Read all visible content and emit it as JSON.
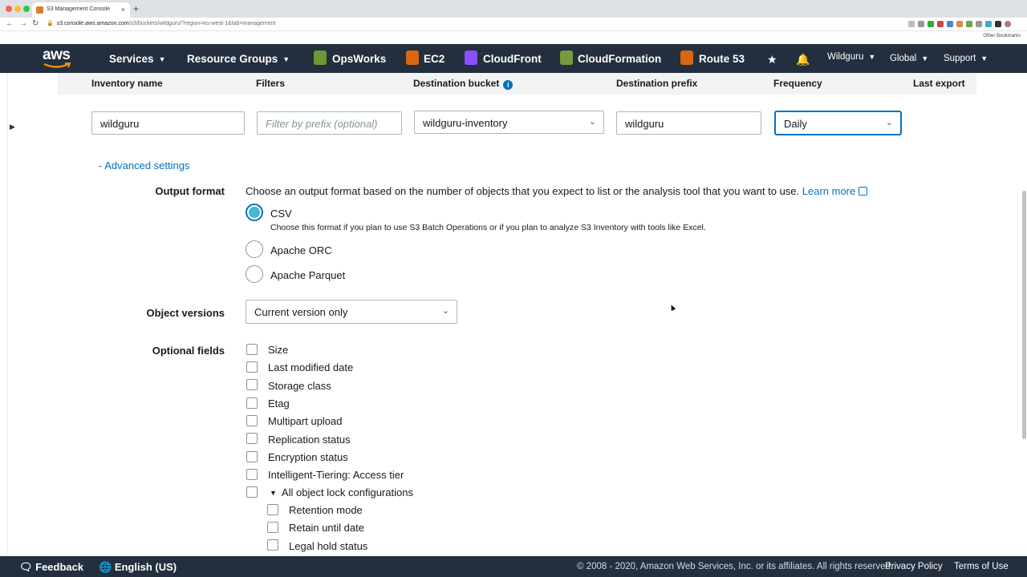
{
  "browser": {
    "tab_title": "S3 Management Console",
    "tab_close": "×",
    "new_tab": "+",
    "url_host": "s3.console.aws.amazon.com",
    "url_path": "/s3/buckets/wildguru/?region=eu-west-1&tab=management",
    "other_bookmarks": "Other Bookmarks"
  },
  "nav": {
    "logo": "aws",
    "services": "Services",
    "resource_groups": "Resource Groups",
    "opsworks": "OpsWorks",
    "ec2": "EC2",
    "cloudfront": "CloudFront",
    "cloudformation": "CloudFormation",
    "route53": "Route 53",
    "account": "Wildguru",
    "region": "Global",
    "support": "Support"
  },
  "columns": {
    "inventory_name": "Inventory name",
    "filters": "Filters",
    "destination_bucket": "Destination bucket",
    "destination_prefix": "Destination prefix",
    "frequency": "Frequency",
    "last_export": "Last export"
  },
  "form": {
    "inventory_name_value": "wildguru",
    "filter_placeholder": "Filter by prefix (optional)",
    "destination_bucket_value": "wildguru-inventory",
    "destination_prefix_value": "wildguru",
    "frequency_value": "Daily"
  },
  "advanced": {
    "toggle_label": "- Advanced settings",
    "output_format_label": "Output format",
    "output_format_desc": "Choose an output format based on the number of objects that you expect to list or the analysis tool that you want to use.",
    "learn_more": "Learn more",
    "formats": [
      {
        "label": "CSV",
        "checked": true
      },
      {
        "label": "Apache ORC",
        "checked": false
      },
      {
        "label": "Apache Parquet",
        "checked": false
      }
    ],
    "csv_hint": "Choose this format if you plan to use S3 Batch Operations or if you plan to analyze S3 Inventory with tools like Excel.",
    "object_versions_label": "Object versions",
    "object_versions_value": "Current version only",
    "optional_fields_label": "Optional fields",
    "optional_fields": [
      "Size",
      "Last modified date",
      "Storage class",
      "Etag",
      "Multipart upload",
      "Replication status",
      "Encryption status",
      "Intelligent-Tiering: Access tier",
      "All object lock configurations"
    ],
    "lock_subfields": [
      "Retention mode",
      "Retain until date",
      "Legal hold status"
    ]
  },
  "footer": {
    "feedback": "Feedback",
    "language": "English (US)",
    "copyright": "© 2008 - 2020, Amazon Web Services, Inc. or its affiliates. All rights reserved.",
    "privacy": "Privacy Policy",
    "terms": "Terms of Use"
  },
  "colors": {
    "nav_bg": "#232f3e",
    "link": "#0073bb",
    "radio_fill": "#44b9d6"
  }
}
